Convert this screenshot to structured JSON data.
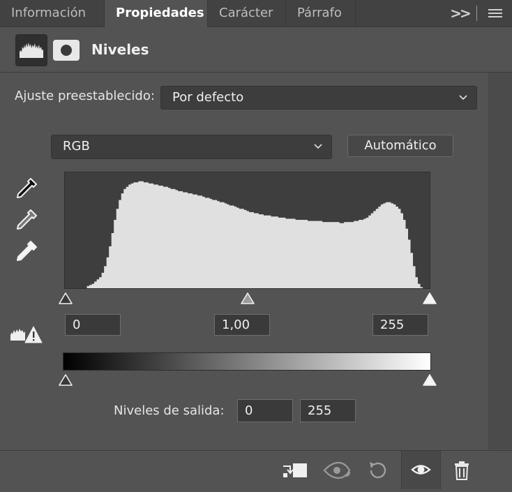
{
  "tabs": {
    "informacion": "Información",
    "propiedades": "Propiedades",
    "caracter": "Carácter",
    "parrafo": "Párrafo"
  },
  "toolbar_icons": {
    "collapse": "double-chevron-right-icon",
    "menu": "hamburger-menu-icon"
  },
  "header": {
    "title": "Niveles",
    "levels_icon": "levels-histogram-icon",
    "mask_icon": "layer-mask-icon"
  },
  "preset": {
    "label": "Ajuste preestablecido:",
    "value": "Por defecto"
  },
  "channel": {
    "value": "RGB"
  },
  "auto_button": "Automático",
  "eyedroppers": [
    "black-point-eyedropper-icon",
    "gray-point-eyedropper-icon",
    "white-point-eyedropper-icon"
  ],
  "input_levels": {
    "black": "0",
    "gamma": "1,00",
    "white": "255"
  },
  "output": {
    "label": "Niveles de salida:",
    "black": "0",
    "white": "255"
  },
  "histogram": {
    "bins": [
      0,
      0,
      0,
      0,
      0,
      0,
      0,
      0,
      0,
      2,
      3,
      4,
      6,
      8,
      10,
      14,
      20,
      28,
      38,
      50,
      62,
      72,
      80,
      86,
      90,
      92,
      94,
      95,
      96,
      96,
      97,
      97,
      96,
      96,
      95,
      95,
      94,
      94,
      93,
      93,
      92,
      92,
      91,
      90,
      90,
      89,
      88,
      88,
      87,
      87,
      86,
      86,
      85,
      85,
      84,
      84,
      83,
      82,
      82,
      81,
      80,
      80,
      79,
      78,
      78,
      77,
      76,
      75,
      75,
      74,
      73,
      72,
      72,
      71,
      70,
      69,
      69,
      68,
      68,
      67,
      67,
      66,
      66,
      66,
      65,
      65,
      65,
      64,
      64,
      64,
      63,
      63,
      63,
      63,
      62,
      62,
      62,
      62,
      62,
      61,
      61,
      61,
      61,
      61,
      61,
      60,
      60,
      60,
      60,
      60,
      60,
      60,
      59,
      59,
      60,
      60,
      60,
      60,
      61,
      61,
      62,
      62,
      63,
      64,
      66,
      68,
      70,
      72,
      74,
      76,
      77,
      78,
      78,
      77,
      76,
      74,
      72,
      68,
      62,
      54,
      44,
      32,
      20,
      10,
      4,
      1,
      0,
      0,
      0
    ],
    "peak_fill": "#e0e0e0"
  },
  "bottom_bar": {
    "clip_icon": "clip-to-layer-icon",
    "preview_icon": "view-previous-state-icon",
    "reset_icon": "reset-icon",
    "visibility_icon": "visibility-eye-icon",
    "delete_icon": "trash-icon"
  },
  "colors": {
    "panel_bg": "#535353",
    "tab_bar_bg": "#424242",
    "field_bg": "#3a3a3a",
    "histogram_bg": "#3e3e3e"
  }
}
